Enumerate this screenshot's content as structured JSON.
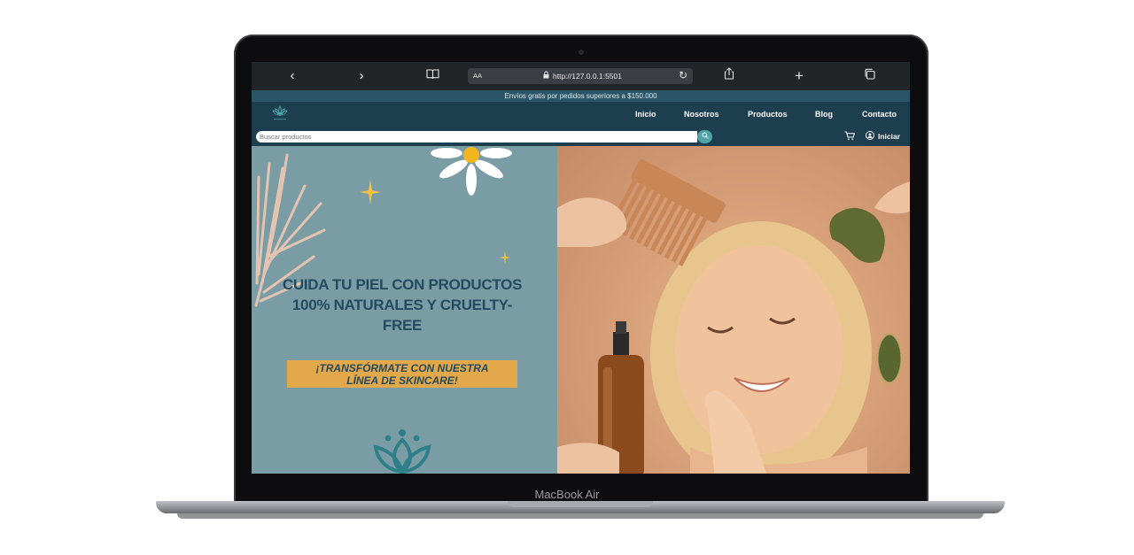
{
  "device": {
    "label": "MacBook Air"
  },
  "browser": {
    "url": "http://127.0.0.1:5501",
    "aa_label": "AA",
    "icons": [
      "back-icon",
      "forward-icon",
      "book-icon",
      "share-icon",
      "new-tab-icon",
      "tabs-icon",
      "lock-icon",
      "reload-icon"
    ]
  },
  "promo": {
    "text": "Envíos gratis por pedidos superiores a $150.000"
  },
  "nav": {
    "items": [
      {
        "label": "Inicio"
      },
      {
        "label": "Nosotros"
      },
      {
        "label": "Productos"
      },
      {
        "label": "Blog"
      },
      {
        "label": "Contacto"
      }
    ]
  },
  "search": {
    "placeholder": "Buscar productos"
  },
  "account": {
    "login_label": "Iniciar"
  },
  "hero": {
    "title_line1": "CUIDA TU PIEL CON PRODUCTOS",
    "title_line2": "100% NATURALES Y CRUELTY-FREE",
    "cta_line1": "¡TRANSFÓRMATE CON NUESTRA",
    "cta_line2": "LÍNEA DE SKINCARE!"
  },
  "colors": {
    "nav_bg": "#1d3e4e",
    "promo_bg": "#2a5568",
    "hero_left_bg": "#7a9ca5",
    "cta_bg": "#e3a84a",
    "accent_teal": "#4fa3a9",
    "title_text": "#234a5e"
  }
}
